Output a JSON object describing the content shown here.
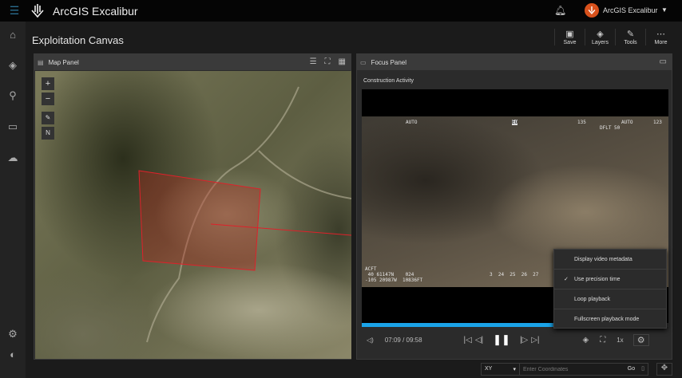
{
  "app": {
    "title": "ArcGIS Excalibur",
    "user": "ArcGIS Excalibur"
  },
  "page": {
    "title": "Exploitation Canvas"
  },
  "toolbar": [
    {
      "label": "Save",
      "icon": "save-icon"
    },
    {
      "label": "Layers",
      "icon": "layers-icon"
    },
    {
      "label": "Tools",
      "icon": "tools-icon"
    },
    {
      "label": "More",
      "icon": "more-icon"
    }
  ],
  "map_panel": {
    "title": "Map Panel",
    "north": "N"
  },
  "focus_panel": {
    "title": "Focus Panel",
    "subtitle": "Construction Activity",
    "hud": {
      "tl": "AUTO",
      "top": "EO",
      "t2": "135",
      "t3": "AUTO",
      "t4": "123",
      "dflt": "DFLT 50",
      "bl": "ACFT\n 40 61147N    024\n-105 20987W  10836FT",
      "bm": "3  24  25  26  27"
    },
    "time": "07:09 / 09:58",
    "progress": 0.717,
    "speed": "1x"
  },
  "settings_menu": [
    {
      "label": "Display video metadata",
      "checked": false
    },
    {
      "label": "Use precision time",
      "checked": true,
      "check": "✓"
    },
    {
      "label": "Loop playback",
      "checked": false
    },
    {
      "label": "Fullscreen playback mode",
      "checked": false
    }
  ],
  "coords": {
    "system": "XY",
    "placeholder": "Enter Coordinates",
    "go": "Go"
  },
  "colors": {
    "accent": "#1aa3e8",
    "brand": "#d8511c",
    "polygon": "#e0202a"
  }
}
